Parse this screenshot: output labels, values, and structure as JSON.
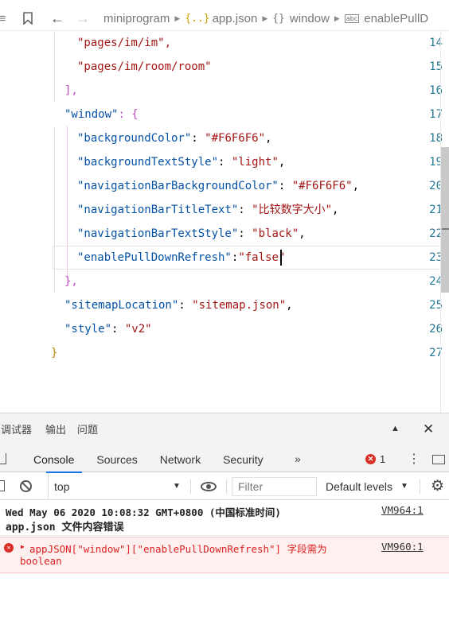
{
  "breadcrumb": {
    "folder": "miniprogram",
    "file": "app.json",
    "object": "window",
    "property": "enablePullD"
  },
  "editor": {
    "lines": [
      {
        "num": "14",
        "text": "\"pages/im/im\","
      },
      {
        "num": "15",
        "text": "\"pages/im/room/room\""
      },
      {
        "num": "16",
        "text": "],"
      },
      {
        "num": "17",
        "key": "\"window\"",
        "rest": ": {"
      },
      {
        "num": "18",
        "key": "\"backgroundColor\"",
        "sep": ": ",
        "val": "\"#F6F6F6\"",
        "end": ","
      },
      {
        "num": "19",
        "key": "\"backgroundTextStyle\"",
        "sep": ": ",
        "val": "\"light\"",
        "end": ","
      },
      {
        "num": "20",
        "key": "\"navigationBarBackgroundColor\"",
        "sep": ": ",
        "val": "\"#F6F6F6\"",
        "end": ","
      },
      {
        "num": "21",
        "key": "\"navigationBarTitleText\"",
        "sep": ": ",
        "val": "\"比较数字大小\"",
        "end": ","
      },
      {
        "num": "22",
        "key": "\"navigationBarTextStyle\"",
        "sep": ": ",
        "val": "\"black\"",
        "end": ","
      },
      {
        "num": "23",
        "key": "\"enablePullDownRefresh\"",
        "sep": ":",
        "val": "\"false\"",
        "end": ""
      },
      {
        "num": "24",
        "text": "},"
      },
      {
        "num": "25",
        "key": "\"sitemapLocation\"",
        "sep": ": ",
        "val": "\"sitemap.json\"",
        "end": ","
      },
      {
        "num": "26",
        "key": "\"style\"",
        "sep": ": ",
        "val": "\"v2\"",
        "end": ""
      },
      {
        "num": "27",
        "text": "}"
      }
    ]
  },
  "devtools": {
    "top_tabs": [
      "调试器",
      "输出",
      "问题"
    ],
    "tabs": [
      "Console",
      "Sources",
      "Network",
      "Security"
    ],
    "more_tabs": "»",
    "error_count": "1",
    "context": "top",
    "filter_placeholder": "Filter",
    "levels": "Default levels",
    "messages": {
      "info_line1": "Wed May 06 2020 10:08:32 GMT+0800 (中国标准时间)",
      "info_line2": "app.json 文件内容错误",
      "info_src": "VM964:1",
      "error_line1": "appJSON[\"window\"][\"enablePullDownRefresh\"] 字段需为",
      "error_line2": "boolean",
      "error_src": "VM960:1"
    }
  },
  "colors": {
    "string": "#a31515",
    "json_key": "#0451a5",
    "line_number": "#237893",
    "accent_tab": "#1a73e8",
    "error": "#d93025"
  }
}
